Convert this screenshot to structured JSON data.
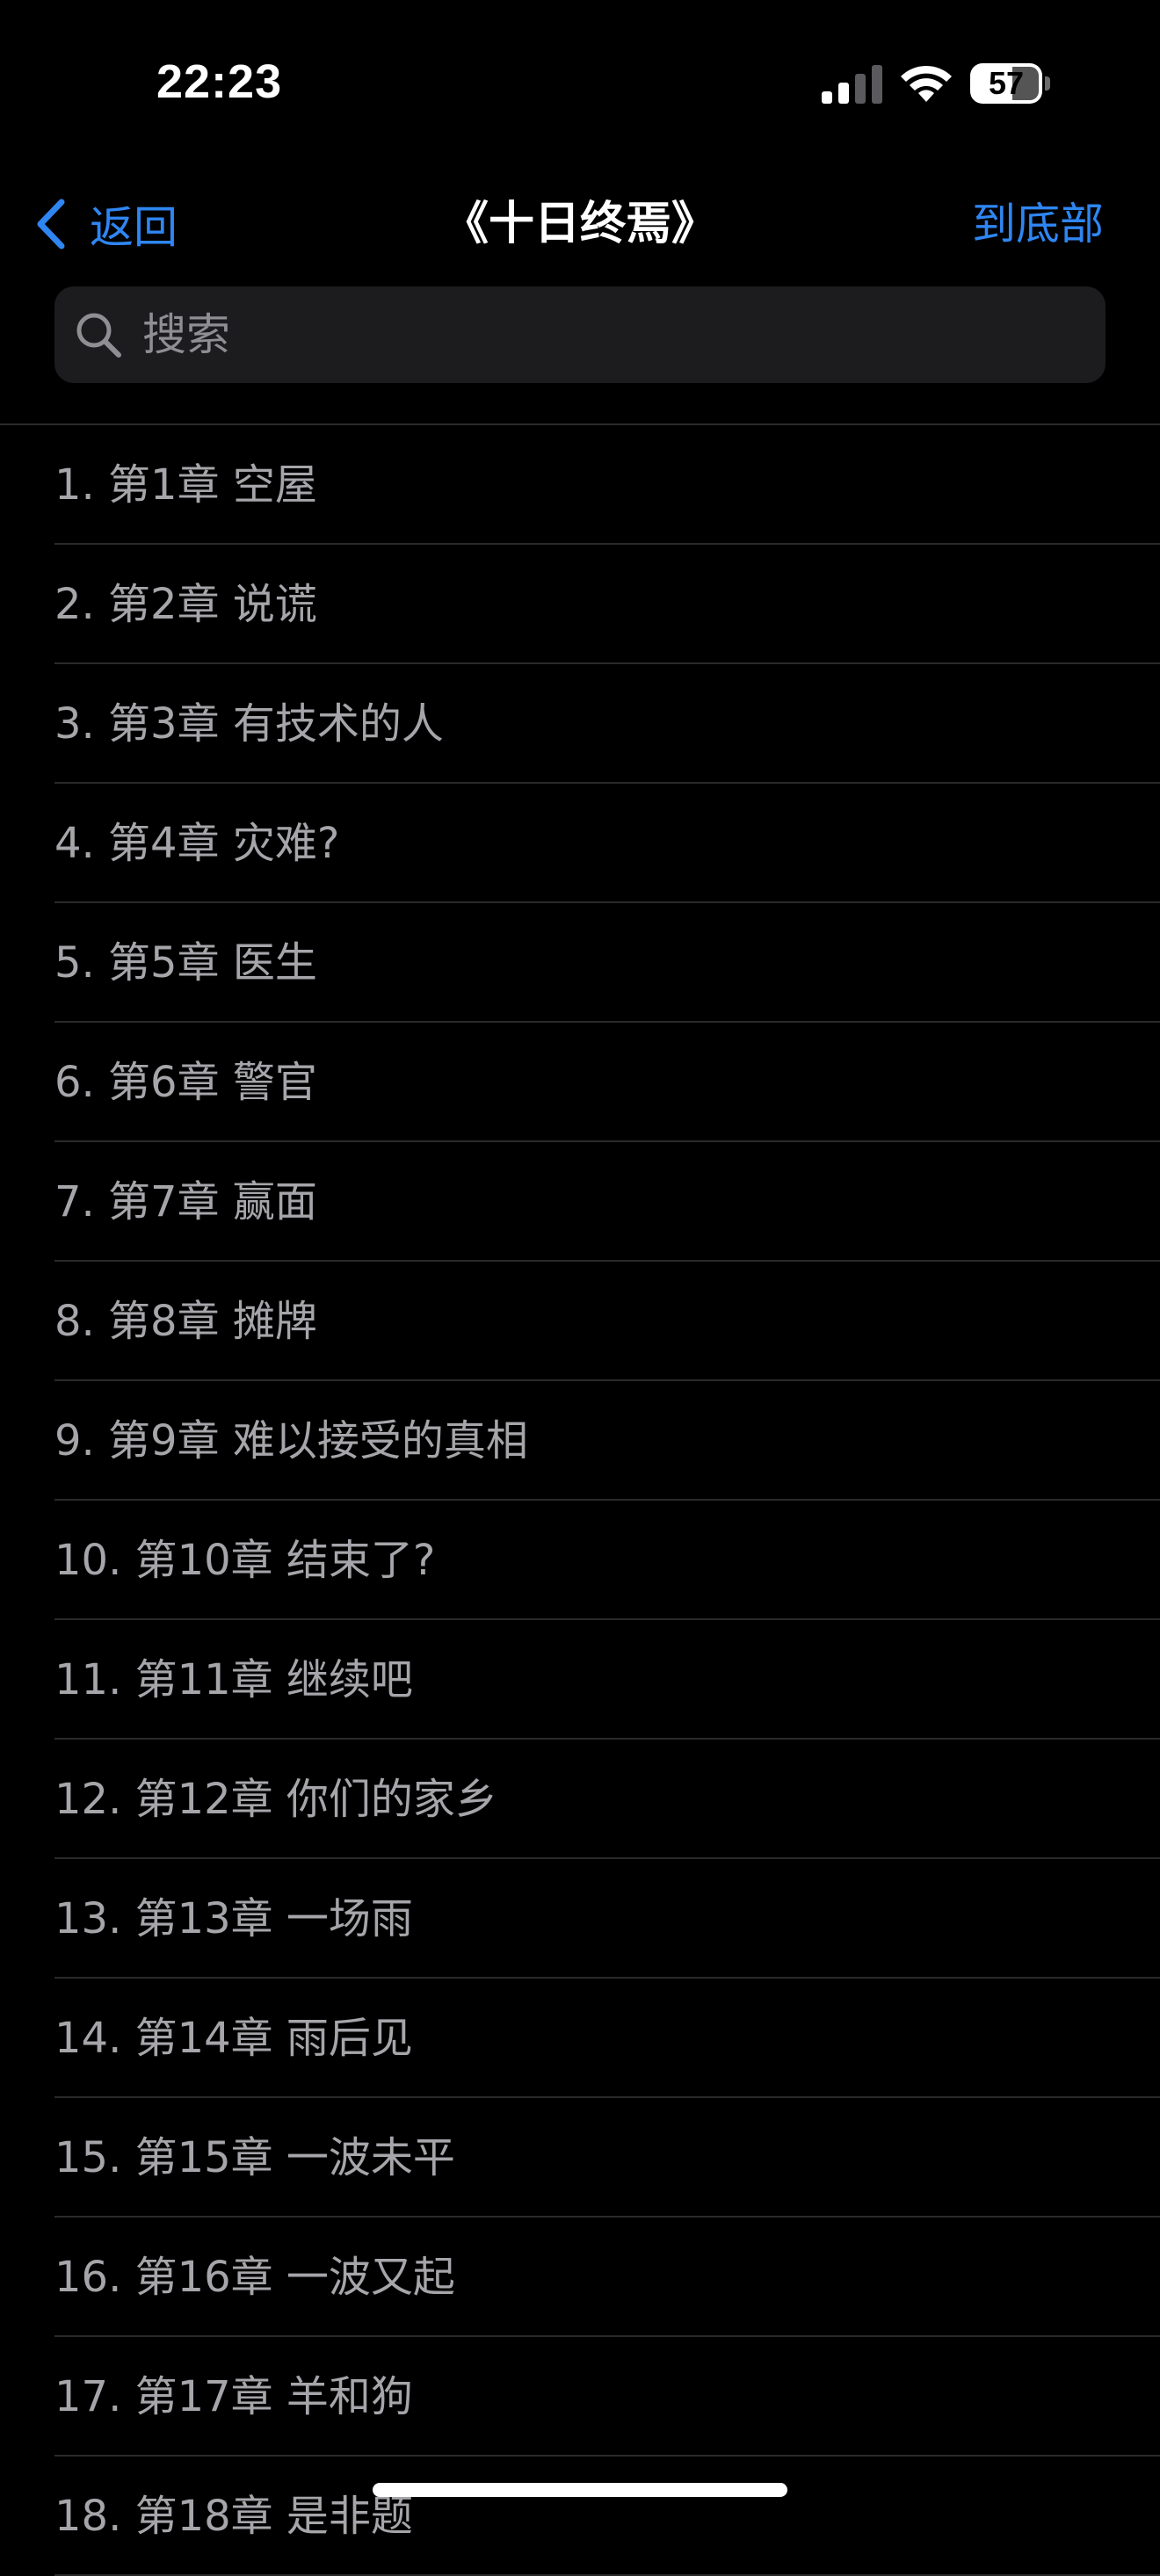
{
  "status_bar": {
    "time": "22:23",
    "battery_level": "57",
    "signal_icon": "cellular-signal-icon",
    "wifi_icon": "wifi-icon"
  },
  "nav": {
    "back_label": "返回",
    "title": "《十日终焉》",
    "to_bottom_label": "到底部"
  },
  "search": {
    "placeholder": "搜索",
    "value": ""
  },
  "colors": {
    "accent": "#2f86f2",
    "background": "#000000",
    "item_text": "#a5a5aa",
    "search_bg": "#1c1c1e"
  },
  "chapters": [
    {
      "label": "1. 第1章 空屋"
    },
    {
      "label": "2. 第2章 说谎"
    },
    {
      "label": "3. 第3章 有技术的人"
    },
    {
      "label": "4. 第4章 灾难?"
    },
    {
      "label": "5. 第5章 医生"
    },
    {
      "label": "6. 第6章 警官"
    },
    {
      "label": "7. 第7章 赢面"
    },
    {
      "label": "8. 第8章 摊牌"
    },
    {
      "label": "9. 第9章 难以接受的真相"
    },
    {
      "label": "10. 第10章 结束了?"
    },
    {
      "label": "11. 第11章 继续吧"
    },
    {
      "label": "12. 第12章 你们的家乡"
    },
    {
      "label": "13. 第13章 一场雨"
    },
    {
      "label": "14. 第14章 雨后见"
    },
    {
      "label": "15. 第15章 一波未平"
    },
    {
      "label": "16. 第16章 一波又起"
    },
    {
      "label": "17. 第17章 羊和狗"
    },
    {
      "label": "18. 第18章 是非题"
    }
  ]
}
